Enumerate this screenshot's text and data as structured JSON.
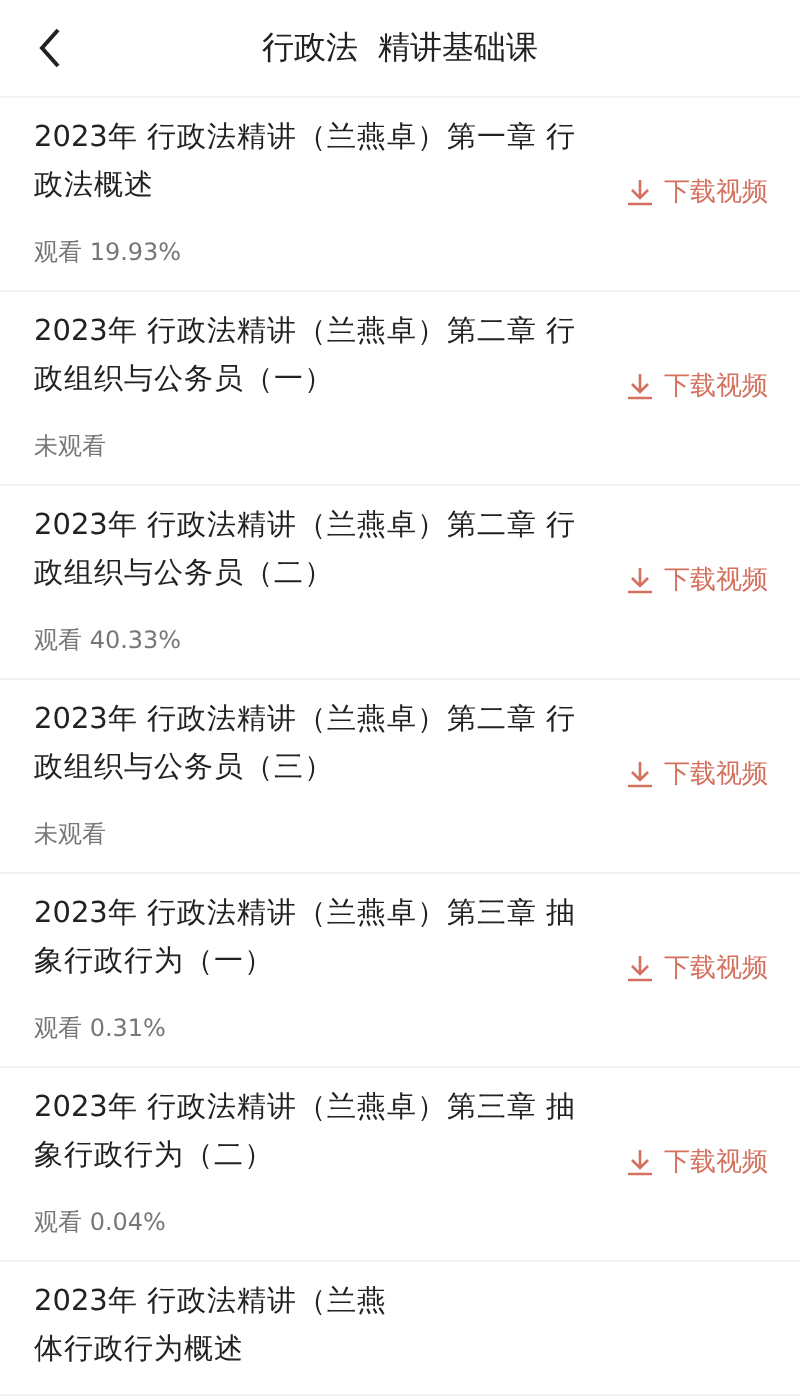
{
  "header": {
    "title": "行政法  精讲基础课"
  },
  "lessons": [
    {
      "title_lines": [
        "2023年 行政法精讲（兰燕卓）第一章 行",
        "政法概述"
      ],
      "progress": "观看 19.93%",
      "download": "下载视频"
    },
    {
      "title_lines": [
        "2023年 行政法精讲（兰燕卓）第二章 行",
        "政组织与公务员（一）"
      ],
      "progress": "未观看",
      "download": "下载视频"
    },
    {
      "title_lines": [
        "2023年 行政法精讲（兰燕卓）第二章 行",
        "政组织与公务员（二）"
      ],
      "progress": "观看 40.33%",
      "download": "下载视频"
    },
    {
      "title_lines": [
        "2023年 行政法精讲（兰燕卓）第二章 行",
        "政组织与公务员（三）"
      ],
      "progress": "未观看",
      "download": "下载视频"
    },
    {
      "title_lines": [
        "2023年 行政法精讲（兰燕卓）第三章 抽",
        "象行政行为（一）"
      ],
      "progress": "观看 0.31%",
      "download": "下载视频"
    },
    {
      "title_lines": [
        "2023年 行政法精讲（兰燕卓）第三章 抽",
        "象行政行为（二）"
      ],
      "progress": "观看 0.04%",
      "download": "下载视频"
    },
    {
      "title_lines": [
        "2023年 行政法精讲（兰燕",
        "体行政行为概述"
      ]
    }
  ]
}
